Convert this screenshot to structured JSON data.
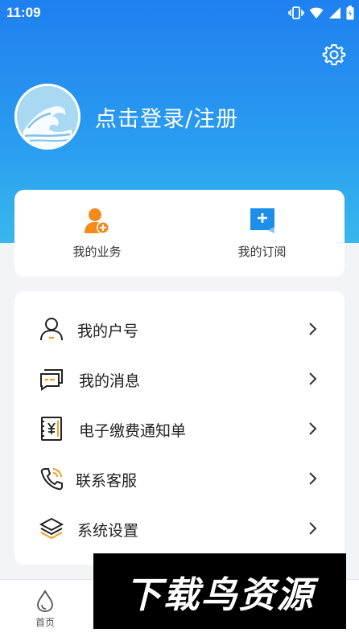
{
  "status_bar": {
    "time": "11:09"
  },
  "colors": {
    "header_top": "#1f80f0",
    "header_bottom": "#38b8ec",
    "accent_orange": "#f28a1c",
    "accent_blue": "#1e8fe8"
  },
  "header": {
    "login_label": "点击登录/注册",
    "settings_icon": "gear-icon",
    "avatar_icon": "wave-avatar-icon"
  },
  "quick_actions": [
    {
      "label": "我的业务",
      "icon": "user-add-icon"
    },
    {
      "label": "我的订阅",
      "icon": "subscribe-bookmark-icon"
    }
  ],
  "menu": [
    {
      "label": "我的户号",
      "icon": "person-icon"
    },
    {
      "label": "我的消息",
      "icon": "message-icon"
    },
    {
      "label": "电子缴费通知单",
      "icon": "bill-yen-icon"
    },
    {
      "label": "联系客服",
      "icon": "phone-icon"
    },
    {
      "label": "系统设置",
      "icon": "layers-icon"
    }
  ],
  "tabbar": {
    "home_label": "首页"
  },
  "watermark": {
    "text": "下载鸟资源"
  }
}
